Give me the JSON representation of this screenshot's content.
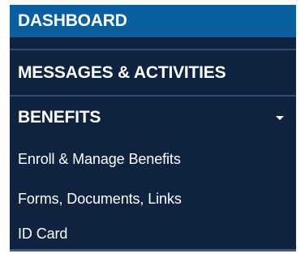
{
  "nav": {
    "items": [
      {
        "label": "DASHBOARD"
      },
      {
        "label": "MESSAGES & ACTIVITIES"
      },
      {
        "label": "BENEFITS",
        "icon": "caret-down-icon"
      }
    ],
    "benefits_submenu": [
      {
        "label": "Enroll & Manage Benefits"
      },
      {
        "label": "Forms, Documents, Links"
      },
      {
        "label": "ID Card"
      }
    ]
  },
  "colors": {
    "nav_background": "#0f2340",
    "active_background": "#0a5f9e",
    "divider": "#2f4c73",
    "text": "#ffffff"
  }
}
